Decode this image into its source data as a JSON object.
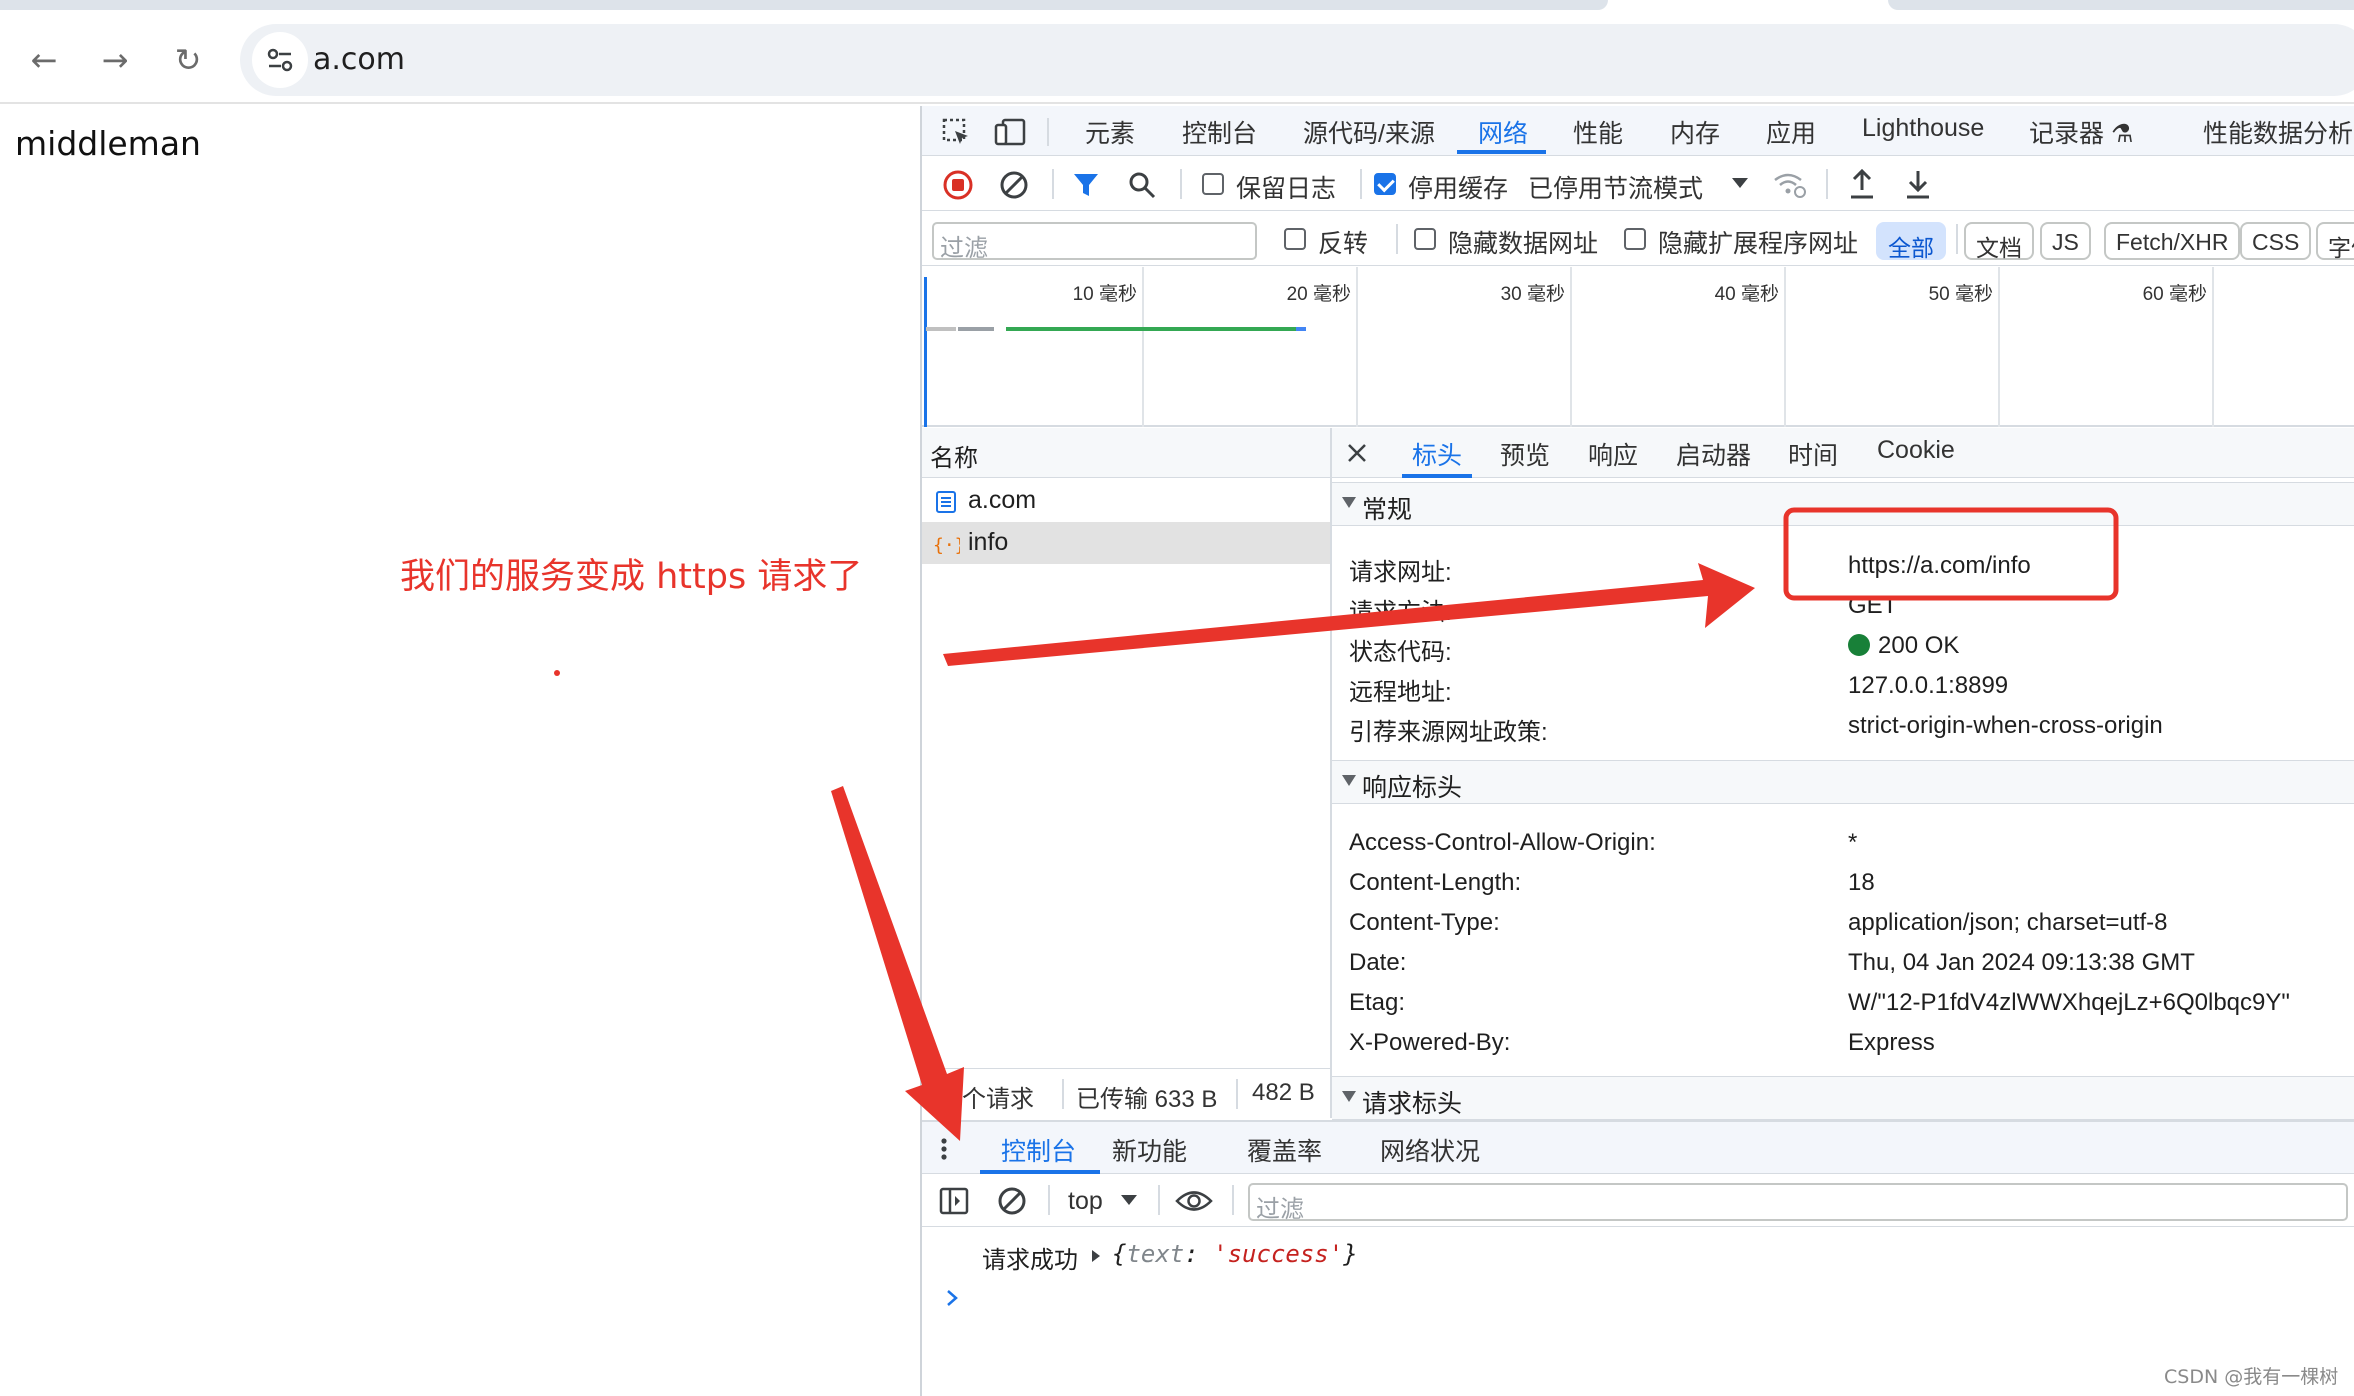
{
  "browser": {
    "url": "a.com",
    "nav": {
      "back": "←",
      "forward": "→",
      "reload": "↻"
    }
  },
  "page": {
    "body_text": "middleman",
    "annotation": "我们的服务变成 https 请求了"
  },
  "devtools": {
    "tabs": [
      "元素",
      "控制台",
      "源代码/来源",
      "网络",
      "性能",
      "内存",
      "应用",
      "Lighthouse",
      "记录器 ⚗",
      "性能数据分析"
    ],
    "active_tab": "网络",
    "network_toolbar": {
      "preserve_log": "保留日志",
      "disable_cache": "停用缓存",
      "throttling": "已停用节流模式"
    },
    "filter_bar": {
      "placeholder": "过滤",
      "invert": "反转",
      "hide_data_urls": "隐藏数据网址",
      "hide_ext_urls": "隐藏扩展程序网址",
      "chips": [
        "全部",
        "文档",
        "JS",
        "Fetch/XHR",
        "CSS",
        "字体"
      ]
    },
    "timeline": {
      "ticks": [
        "10 毫秒",
        "20 毫秒",
        "30 毫秒",
        "40 毫秒",
        "50 毫秒",
        "60 毫秒"
      ]
    },
    "request_list": {
      "header": "名称",
      "rows": [
        {
          "name": "a.com",
          "icon": "document-icon"
        },
        {
          "name": "info",
          "icon": "fetch-icon"
        }
      ],
      "status": {
        "requests": "个请求",
        "transferred": "已传输 633 B",
        "resources": "482 B"
      }
    },
    "detail": {
      "tabs": [
        "标头",
        "预览",
        "响应",
        "启动器",
        "时间",
        "Cookie"
      ],
      "active_tab": "标头",
      "general": {
        "title": "常规",
        "rows": [
          {
            "key": "请求网址:",
            "value": "https://a.com/info"
          },
          {
            "key": "请求方法:",
            "value": "GET"
          },
          {
            "key": "状态代码:",
            "value": "200 OK"
          },
          {
            "key": "远程地址:",
            "value": "127.0.0.1:8899"
          },
          {
            "key": "引荐来源网址政策:",
            "value": "strict-origin-when-cross-origin"
          }
        ]
      },
      "response_headers": {
        "title": "响应标头",
        "rows": [
          {
            "key": "Access-Control-Allow-Origin:",
            "value": "*"
          },
          {
            "key": "Content-Length:",
            "value": "18"
          },
          {
            "key": "Content-Type:",
            "value": "application/json; charset=utf-8"
          },
          {
            "key": "Date:",
            "value": "Thu, 04 Jan 2024 09:13:38 GMT"
          },
          {
            "key": "Etag:",
            "value": "W/\"12-P1fdV4zlWWXhqejLz+6Q0lbqc9Y\""
          },
          {
            "key": "X-Powered-By:",
            "value": "Express"
          }
        ]
      },
      "request_headers": {
        "title": "请求标头"
      }
    },
    "drawer": {
      "tabs": [
        "控制台",
        "新功能",
        "覆盖率",
        "网络状况"
      ],
      "active_tab": "控制台",
      "context": "top",
      "filter_placeholder": "过滤",
      "log": {
        "message": "请求成功",
        "object_open": "{",
        "key": "text",
        "colon": ": ",
        "value": "'success'",
        "object_close": "}"
      }
    }
  },
  "watermark": "CSDN @我有一棵树",
  "colors": {
    "accent": "#1a73e8",
    "annotation": "#e8342b",
    "status_ok": "#188038"
  }
}
